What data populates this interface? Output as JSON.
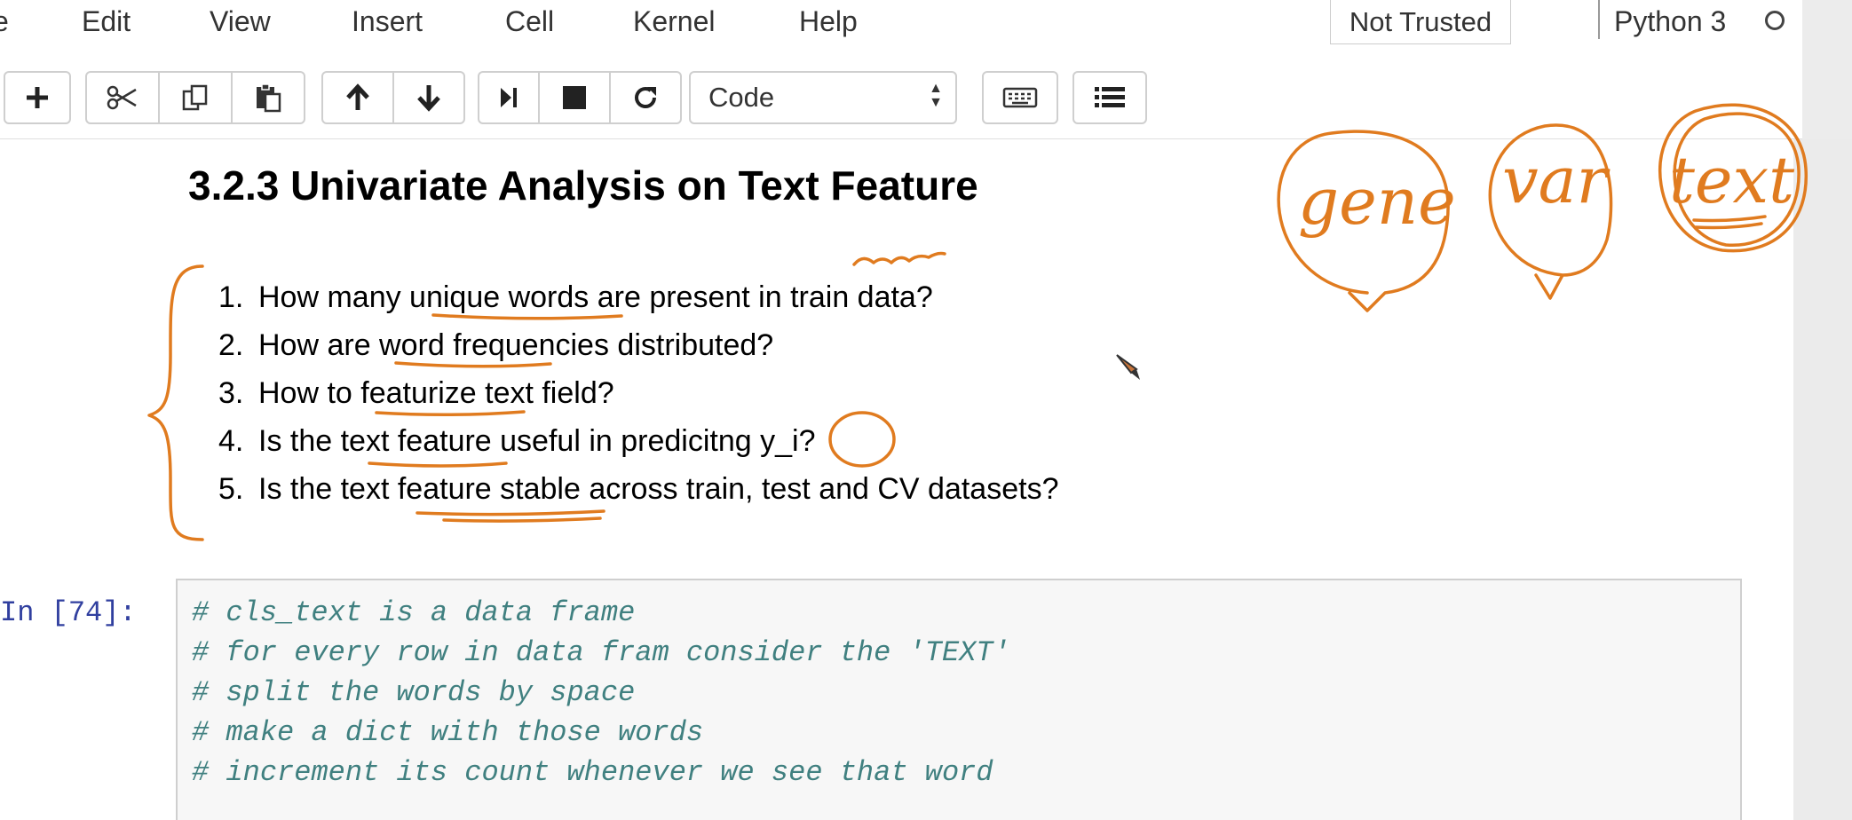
{
  "menu": {
    "items": [
      "e",
      "Edit",
      "View",
      "Insert",
      "Cell",
      "Kernel",
      "Help"
    ],
    "trust_status": "Not Trusted",
    "kernel_name": "Python 3"
  },
  "toolbar": {
    "cell_type": "Code",
    "icons": [
      "add-cell-icon",
      "cut-icon",
      "copy-icon",
      "paste-icon",
      "move-up-icon",
      "move-down-icon",
      "run-icon",
      "stop-icon",
      "restart-icon",
      "keyboard-icon",
      "command-palette-icon"
    ]
  },
  "markdown_cell": {
    "heading": "3.2.3 Univariate Analysis on Text Feature",
    "list": [
      {
        "num": "1.",
        "text": "How many unique words are present in train data?"
      },
      {
        "num": "2.",
        "text": "How are word frequencies distributed?"
      },
      {
        "num": "3.",
        "text": "How to featurize text field?"
      },
      {
        "num": "4.",
        "text": "Is the text feature useful in predicitng y_i?"
      },
      {
        "num": "5.",
        "text": "Is the text feature stable across train, test and CV datasets?"
      }
    ]
  },
  "code_cell": {
    "prompt": "In [74]:",
    "lines": [
      "# cls_text is a data frame",
      "# for every row in data fram consider the 'TEXT'",
      "# split the words by space",
      "# make a dict with those words",
      "# increment its count whenever we see that word"
    ]
  },
  "annotations": {
    "handwritten_words": [
      "gene",
      "var",
      "text"
    ],
    "ink_color": "#e07b1f"
  }
}
